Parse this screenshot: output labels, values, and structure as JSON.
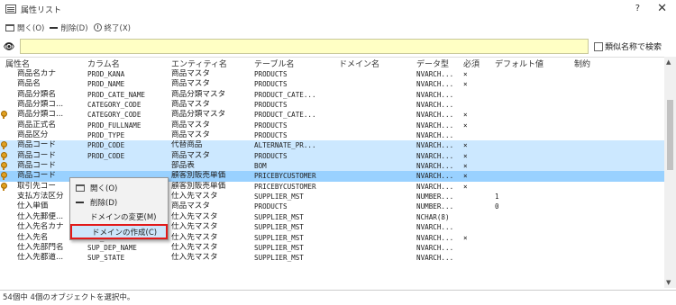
{
  "window": {
    "title": "属性リスト",
    "help": "?",
    "close": "✕"
  },
  "toolbar": {
    "open": "開く(O)",
    "delete": "削除(D)",
    "exit": "終了(X)"
  },
  "search": {
    "value": "",
    "similar_label": "類似名称で検索"
  },
  "columns": [
    "属性名",
    "カラム名",
    "エンティティ名",
    "テーブル名",
    "ドメイン名",
    "データ型",
    "必須",
    "デフォルト値",
    "制約"
  ],
  "rows": [
    {
      "key": false,
      "sel": "",
      "cells": [
        "商品名カナ",
        "PROD_KANA",
        "商品マスタ",
        "PRODUCTS",
        "",
        "NVARCH...",
        "×",
        "",
        ""
      ]
    },
    {
      "key": false,
      "sel": "",
      "cells": [
        "商品名",
        "PROD_NAME",
        "商品マスタ",
        "PRODUCTS",
        "",
        "NVARCH...",
        "×",
        "",
        ""
      ]
    },
    {
      "key": false,
      "sel": "",
      "cells": [
        "商品分類名",
        "PROD_CATE_NAME",
        "商品分類マスタ",
        "PRODUCT_CATE...",
        "",
        "NVARCH...",
        "",
        "",
        ""
      ]
    },
    {
      "key": false,
      "sel": "",
      "cells": [
        "商品分類コ...",
        "CATEGORY_CODE",
        "商品マスタ",
        "PRODUCTS",
        "",
        "NVARCH...",
        "",
        "",
        ""
      ]
    },
    {
      "key": true,
      "sel": "",
      "cells": [
        "商品分類コ...",
        "CATEGORY_CODE",
        "商品分類マスタ",
        "PRODUCT_CATE...",
        "",
        "NVARCH...",
        "×",
        "",
        ""
      ]
    },
    {
      "key": false,
      "sel": "",
      "cells": [
        "商品正式名",
        "PROD_FULLNAME",
        "商品マスタ",
        "PRODUCTS",
        "",
        "NVARCH...",
        "×",
        "",
        ""
      ]
    },
    {
      "key": false,
      "sel": "",
      "cells": [
        "商品区分",
        "PROD_TYPE",
        "商品マスタ",
        "PRODUCTS",
        "",
        "NVARCH...",
        "",
        "",
        ""
      ]
    },
    {
      "key": true,
      "sel": "sel",
      "cells": [
        "商品コード",
        "PROD_CODE",
        "代替商品",
        "ALTERNATE_PR...",
        "",
        "NVARCH...",
        "×",
        "",
        ""
      ]
    },
    {
      "key": true,
      "sel": "sel",
      "cells": [
        "商品コード",
        "PROD_CODE",
        "商品マスタ",
        "PRODUCTS",
        "",
        "NVARCH...",
        "×",
        "",
        ""
      ]
    },
    {
      "key": true,
      "sel": "sel",
      "cells": [
        "商品コード",
        "",
        "部品表",
        "BOM",
        "",
        "NVARCH...",
        "×",
        "",
        ""
      ]
    },
    {
      "key": true,
      "sel": "sel strong",
      "cells": [
        "商品コード",
        "",
        "顧客別販売単価",
        "PRICEBYCUSTOMER",
        "",
        "NVARCH...",
        "×",
        "",
        ""
      ]
    },
    {
      "key": true,
      "sel": "",
      "cells": [
        "取引先コー",
        "",
        "顧客別販売単価",
        "PRICEBYCUSTOMER",
        "",
        "NVARCH...",
        "×",
        "",
        ""
      ]
    },
    {
      "key": false,
      "sel": "",
      "cells": [
        "支払方法区分",
        "",
        "仕入先マスタ",
        "SUPPLIER_MST",
        "",
        "NUMBER...",
        "",
        "1",
        ""
      ]
    },
    {
      "key": false,
      "sel": "",
      "cells": [
        "仕入単価",
        "",
        "商品マスタ",
        "PRODUCTS",
        "",
        "NUMBER...",
        "",
        "0",
        ""
      ]
    },
    {
      "key": false,
      "sel": "",
      "cells": [
        "仕入先郵便...",
        "",
        "仕入先マスタ",
        "SUPPLIER_MST",
        "",
        "NCHAR(8)",
        "",
        "",
        ""
      ]
    },
    {
      "key": false,
      "sel": "",
      "cells": [
        "仕入先名カナ",
        "SUP_KANA",
        "仕入先マスタ",
        "SUPPLIER_MST",
        "",
        "NVARCH...",
        "",
        "",
        ""
      ]
    },
    {
      "key": false,
      "sel": "",
      "cells": [
        "仕入先名",
        "SUP_NAME",
        "仕入先マスタ",
        "SUPPLIER_MST",
        "",
        "NVARCH...",
        "×",
        "",
        ""
      ]
    },
    {
      "key": false,
      "sel": "",
      "cells": [
        "仕入先部門名",
        "SUP_DEP_NAME",
        "仕入先マスタ",
        "SUPPLIER_MST",
        "",
        "NVARCH...",
        "",
        "",
        ""
      ]
    },
    {
      "key": false,
      "sel": "",
      "cells": [
        "仕入先都道...",
        "SUP_STATE",
        "仕入先マスタ",
        "SUPPLIER_MST",
        "",
        "NVARCH...",
        "",
        "",
        ""
      ]
    }
  ],
  "context_menu": {
    "open": "開く(O)",
    "delete": "削除(D)",
    "change_domain": "ドメインの変更(M)",
    "create_domain": "ドメインの作成(C)"
  },
  "status": "54個中 4個のオブジェクトを選択中。"
}
